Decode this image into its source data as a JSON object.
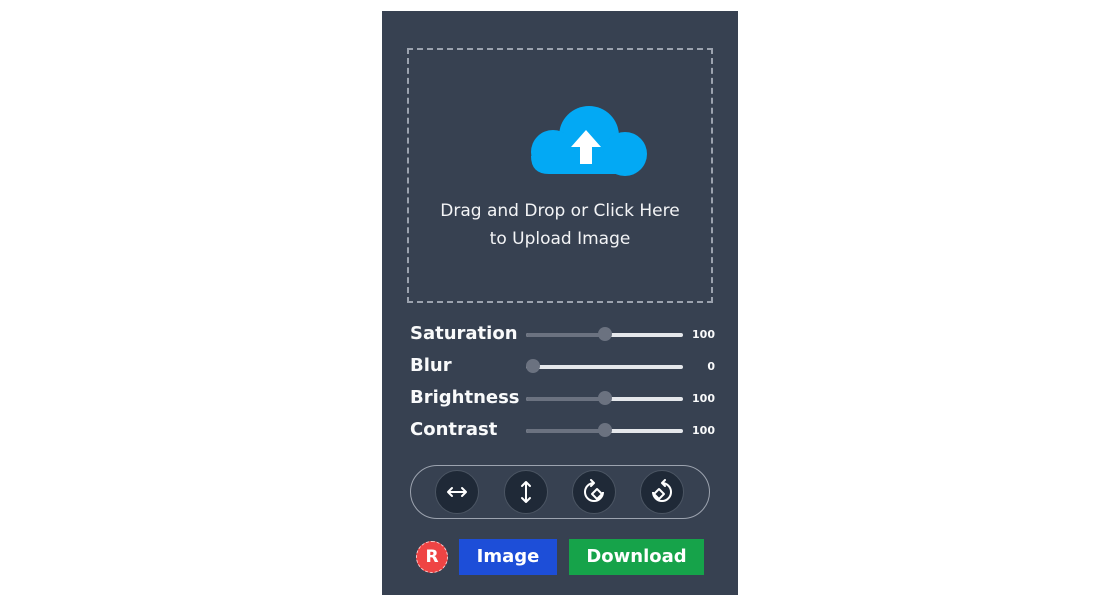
{
  "upload": {
    "icon": "cloud-upload-icon",
    "line1": "Drag and Drop or Click Here",
    "line2": "to Upload Image",
    "accent": "#03a9f4"
  },
  "filters": [
    {
      "label": "Saturation",
      "value": "100",
      "fraction": 0.5
    },
    {
      "label": "Blur",
      "value": "0",
      "fraction": 0.0
    },
    {
      "label": "Brightness",
      "value": "100",
      "fraction": 0.5
    },
    {
      "label": "Contrast",
      "value": "100",
      "fraction": 0.5
    }
  ],
  "transforms": [
    {
      "icon": "flip-horizontal-icon"
    },
    {
      "icon": "flip-vertical-icon"
    },
    {
      "icon": "rotate-right-icon"
    },
    {
      "icon": "rotate-left-icon"
    }
  ],
  "actions": {
    "reset_label": "R",
    "image_label": "Image",
    "download_label": "Download"
  },
  "colors": {
    "panel": "#374151",
    "image_button": "#1d4ed8",
    "download_button": "#16a34a",
    "reset_button": "#ef4444"
  }
}
